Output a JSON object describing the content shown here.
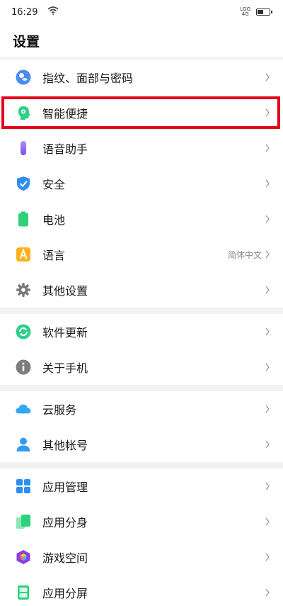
{
  "status_bar": {
    "time": "16:29",
    "network_label_top": "LOG",
    "network_label_bottom": "4G",
    "icons": [
      "wifi-icon",
      "battery-icon"
    ]
  },
  "page_title": "设置",
  "groups": [
    {
      "items": [
        {
          "label": "指纹、面部与密码",
          "icon": "fingerprint-face-icon",
          "value": ""
        },
        {
          "label": "智能便捷",
          "icon": "smart-assist-icon",
          "value": "",
          "highlighted": true
        },
        {
          "label": "语音助手",
          "icon": "microphone-icon",
          "value": ""
        },
        {
          "label": "安全",
          "icon": "shield-icon",
          "value": ""
        },
        {
          "label": "电池",
          "icon": "battery-icon",
          "value": ""
        },
        {
          "label": "语言",
          "icon": "language-icon",
          "value": "简体中文"
        },
        {
          "label": "其他设置",
          "icon": "gear-icon",
          "value": ""
        }
      ]
    },
    {
      "items": [
        {
          "label": "软件更新",
          "icon": "update-icon",
          "value": ""
        },
        {
          "label": "关于手机",
          "icon": "info-icon",
          "value": ""
        }
      ]
    },
    {
      "items": [
        {
          "label": "云服务",
          "icon": "cloud-icon",
          "value": ""
        },
        {
          "label": "其他帐号",
          "icon": "person-icon",
          "value": ""
        }
      ]
    },
    {
      "items": [
        {
          "label": "应用管理",
          "icon": "apps-grid-icon",
          "value": ""
        },
        {
          "label": "应用分身",
          "icon": "app-clone-icon",
          "value": ""
        },
        {
          "label": "游戏空间",
          "icon": "game-cube-icon",
          "value": ""
        },
        {
          "label": "应用分屏",
          "icon": "split-screen-icon",
          "value": ""
        }
      ]
    }
  ],
  "colors": {
    "highlight": "#e4001b",
    "separator": "#f1f1f1",
    "chevron": "#9a9a9a"
  }
}
